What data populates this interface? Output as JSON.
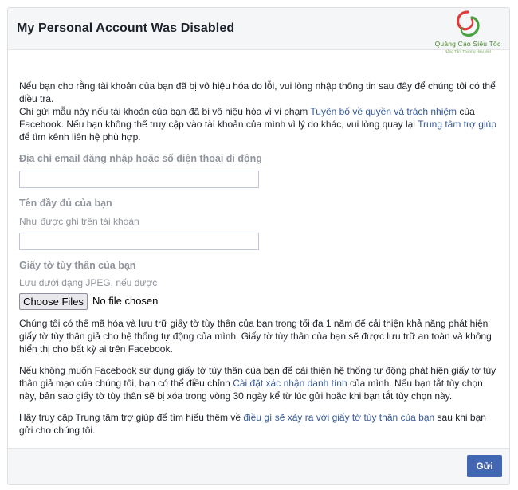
{
  "header": {
    "title": "My Personal Account Was Disabled",
    "logo_text": "Quảng Cáo Siêu Tốc",
    "logo_subtext": "Nâng Tầm Thương Hiệu Việt"
  },
  "intro": {
    "paragraph1": "Nếu bạn cho rằng tài khoản của bạn đã bị vô hiệu hóa do lỗi, vui lòng nhập thông tin sau đây để chúng tôi có thể điều tra.",
    "paragraph2_part1": "Chỉ gửi mẫu này nếu tài khoản của bạn đã bị vô hiệu hóa vì vi phạm ",
    "paragraph2_link1": "Tuyên bố về quyền và trách nhiệm",
    "paragraph2_part2": " của Facebook. Nếu bạn không thể truy cập vào tài khoản của mình vì lý do khác, vui lòng quay lại ",
    "paragraph2_link2": "Trung tâm trợ giúp",
    "paragraph2_part3": " để tìm kênh liên hệ phù hợp."
  },
  "form": {
    "email_label": "Địa chỉ email đăng nhập hoặc số điện thoại di động",
    "email_value": "",
    "name_label": "Tên đầy đủ của bạn",
    "name_hint": "Như được ghi trên tài khoản",
    "name_value": "",
    "id_label": "Giấy tờ tùy thân của bạn",
    "id_hint": "Lưu dưới dạng JPEG, nếu được",
    "choose_files_label": "Choose Files",
    "no_file_text": "No file chosen"
  },
  "notes": {
    "paragraph3": "Chúng tôi có thể mã hóa và lưu trữ giấy tờ tùy thân của bạn trong tối đa 1 năm để cải thiện khả năng phát hiện giấy tờ tùy thân giả cho hệ thống tự động của mình. Giấy tờ tùy thân của bạn sẽ được lưu trữ an toàn và không hiển thị cho bất kỳ ai trên Facebook.",
    "paragraph4_part1": "Nếu không muốn Facebook sử dụng giấy tờ tùy thân của bạn để cải thiện hệ thống tự động phát hiện giấy tờ tùy thân giả mạo của chúng tôi, bạn có thể điều chỉnh ",
    "paragraph4_link": "Cài đặt xác nhận danh tính",
    "paragraph4_part2": " của mình. Nếu bạn tắt tùy chọn này, bản sao giấy tờ tùy thân sẽ bị xóa trong vòng 30 ngày kể từ lúc gửi hoặc khi bạn tắt tùy chọn này.",
    "paragraph5_part1": "Hãy truy cập Trung tâm trợ giúp để tìm hiểu thêm về ",
    "paragraph5_link": "điều gì sẽ xảy ra với giấy tờ tùy thân của bạn",
    "paragraph5_part2": " sau khi bạn gửi cho chúng tôi."
  },
  "footer": {
    "submit_label": "Gửi"
  },
  "colors": {
    "link": "#365899",
    "primary_button": "#4267b2",
    "label_gray": "#90949c",
    "header_bg": "#f5f6f7"
  }
}
